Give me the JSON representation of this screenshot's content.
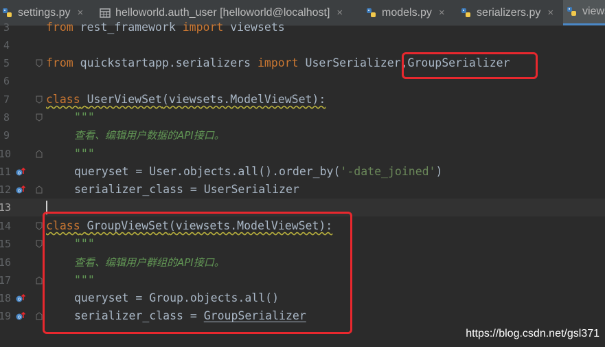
{
  "tabs": [
    {
      "label": "settings.py",
      "icon": "python-file-icon",
      "active": false
    },
    {
      "label": "helloworld.auth_user [helloworld@localhost]",
      "icon": "table-icon",
      "active": false
    },
    {
      "label": "models.py",
      "icon": "python-file-icon",
      "active": false
    },
    {
      "label": "serializers.py",
      "icon": "python-file-icon",
      "active": false
    },
    {
      "label": "views",
      "icon": "python-file-icon",
      "active": true
    }
  ],
  "close_glyph": "×",
  "lines": [
    {
      "num": "3",
      "text": "from rest_framework import viewsets"
    },
    {
      "num": "4",
      "text": ""
    },
    {
      "num": "5",
      "text": "from quickstartapp.serializers import UserSerializer,GroupSerializer"
    },
    {
      "num": "6",
      "text": ""
    },
    {
      "num": "7",
      "text": "class UserViewSet(viewsets.ModelViewSet):"
    },
    {
      "num": "8",
      "text": "\"\"\""
    },
    {
      "num": "9",
      "text": "查看、编辑用户数据的API接口。"
    },
    {
      "num": "10",
      "text": "\"\"\""
    },
    {
      "num": "11",
      "text": "queryset = User.objects.all().order_by('-date_joined')"
    },
    {
      "num": "12",
      "text": "serializer_class = UserSerializer"
    },
    {
      "num": "13",
      "text": ""
    },
    {
      "num": "14",
      "text": "class GroupViewSet(viewsets.ModelViewSet):"
    },
    {
      "num": "15",
      "text": "\"\"\""
    },
    {
      "num": "16",
      "text": "查看、编辑用户群组的API接口。"
    },
    {
      "num": "17",
      "text": "\"\"\""
    },
    {
      "num": "18",
      "text": "queryset = Group.objects.all()"
    },
    {
      "num": "19",
      "text": "serializer_class = GroupSerializer"
    }
  ],
  "code": {
    "l3": {
      "kw1": "from",
      "mod": " rest_framework ",
      "kw2": "import",
      "name": " viewsets"
    },
    "l5": {
      "kw1": "from",
      "mod": " quickstartapp.serializers ",
      "kw2": "import",
      "names": " UserSerializer,GroupSerializer"
    },
    "l7": {
      "kw": "class",
      "sp": " ",
      "name": "UserViewSet",
      "rest": "(viewsets.ModelViewSet):"
    },
    "l8": {
      "doc": "\"\"\""
    },
    "l9": {
      "doc": "查看、编辑用户数据的API接口。"
    },
    "l10": {
      "doc": "\"\"\""
    },
    "l11": {
      "pre": "queryset = User.objects.all().order_by(",
      "str": "'-date_joined'",
      "post": ")"
    },
    "l12": {
      "text": "serializer_class = UserSerializer"
    },
    "l14": {
      "kw": "class",
      "sp": " ",
      "name": "GroupViewSet",
      "rest": "(viewsets.ModelViewSet):"
    },
    "l15": {
      "doc": "\"\"\""
    },
    "l16": {
      "doc": "查看、编辑用户群组的API接口。"
    },
    "l17": {
      "doc": "\"\"\""
    },
    "l18": {
      "text": "queryset = Group.objects.all()"
    },
    "l19": {
      "pre": "serializer_class = ",
      "name": "GroupSerializer"
    }
  },
  "watermark": "https://blog.csdn.net/gsl371",
  "colors": {
    "background": "#2b2b2b",
    "keyword": "#cc7832",
    "text": "#a9b7c6",
    "string": "#6a8759",
    "docstring": "#629755",
    "highlight_box": "#e8282e",
    "line_number": "#606366"
  }
}
